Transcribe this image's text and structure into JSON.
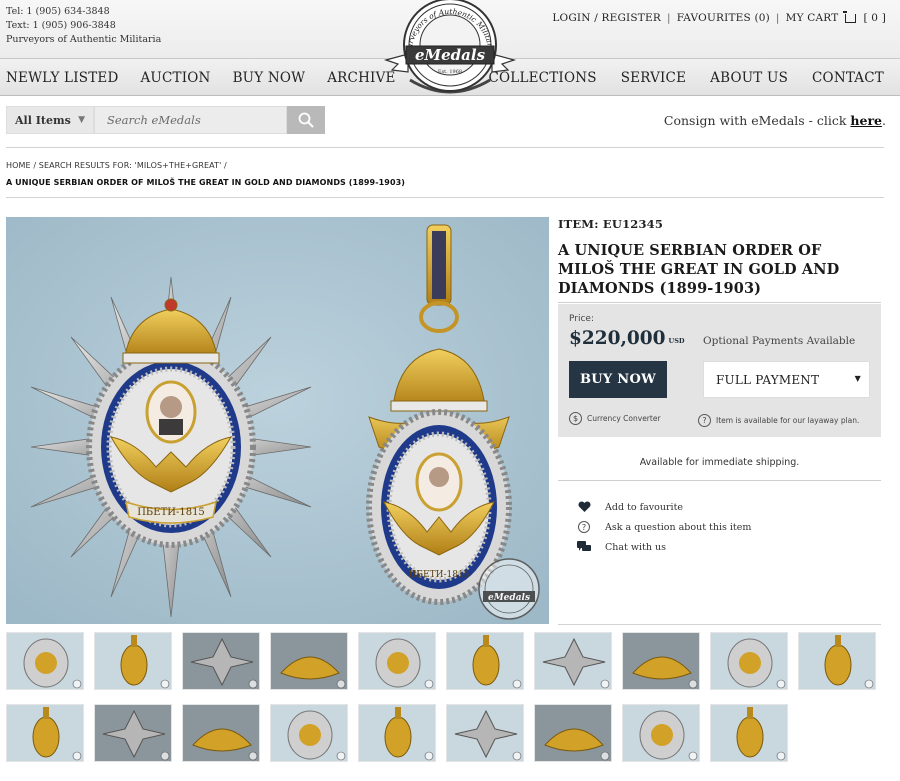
{
  "header": {
    "contact": [
      "Tel: 1 (905) 634-3848",
      "Text: 1 (905) 906-3848",
      "Purveyors of Authentic Militaria"
    ],
    "user_links": {
      "login": "LOGIN / REGISTER",
      "favourites": "FAVOURITES (0)",
      "cart": "MY CART",
      "cart_count": "[ 0 ]"
    },
    "logo": {
      "wordmark": "eMedals",
      "ring_text": "Purveyors of Authentic Militaria",
      "est": "Est. 1968"
    }
  },
  "nav": {
    "left": [
      "NEWLY LISTED",
      "AUCTION",
      "BUY NOW",
      "ARCHIVE"
    ],
    "right": [
      "COLLECTIONS",
      "SERVICE",
      "ABOUT US",
      "CONTACT"
    ]
  },
  "search": {
    "scope": "All Items",
    "placeholder": "Search eMedals",
    "consign_text": "Consign with eMedals - click",
    "consign_link": "here",
    "consign_end": "."
  },
  "breadcrumb": {
    "home": "HOME",
    "search": "SEARCH RESULTS FOR: 'MILOS+THE+GREAT'",
    "current": "A UNIQUE SERBIAN ORDER OF MILOŠ THE GREAT IN GOLD AND DIAMONDS (1899-1903)"
  },
  "product": {
    "item_no": "ITEM: EU12345",
    "title": "A UNIQUE SERBIAN ORDER OF MILOŠ THE GREAT IN GOLD AND DIAMONDS (1899-1903)",
    "price_label": "Price:",
    "price": "$220,000",
    "currency": "USD",
    "optional_payments": "Optional Payments Available",
    "buy_now": "BUY NOW",
    "payment_option": "FULL PAYMENT",
    "currency_converter": "Currency Converter",
    "layaway": "Item is available for our layaway plan.",
    "shipping": "Available for immediate shipping.",
    "actions": [
      "Add to favourite",
      "Ask a question about this item",
      "Chat with us"
    ],
    "image_watermark": "eMedals",
    "medal_inscription": "ПБЕТИ-1815"
  },
  "thumbnails": {
    "row1_count": 10,
    "row2_count": 9
  },
  "colors": {
    "accent": "#263543",
    "price": "#1f2f3c",
    "panel": "#e4e4e4",
    "photo_bg": "#aec6d3",
    "gold": "#d1a128"
  }
}
